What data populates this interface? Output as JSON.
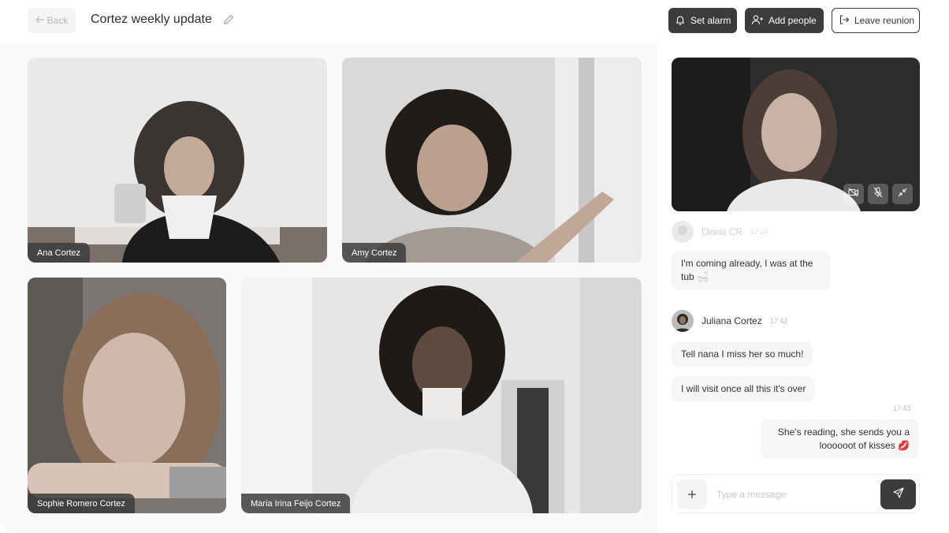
{
  "header": {
    "back_label": "Back",
    "title": "Cortez weekly update",
    "set_alarm_label": "Set alarm",
    "add_people_label": "Add people",
    "leave_label": "Leave reunion"
  },
  "participants": [
    {
      "name": "Ana Cortez"
    },
    {
      "name": "Amy Cortez"
    },
    {
      "name": "Sophie Romero Cortez"
    },
    {
      "name": "Maria Irina Feijo Cortez"
    }
  ],
  "chat": {
    "messages": [
      {
        "sender": "Diana CR",
        "time": "17:34",
        "bubbles": [
          "I'm coming already, I was at the tub 🛁"
        ]
      },
      {
        "sender": "Juliana Cortez",
        "time": "17:42",
        "bubbles": [
          "Tell nana I miss her so much!",
          "I will visit once all this it's over"
        ]
      },
      {
        "sender": "me",
        "time": "17:43",
        "bubbles": [
          "She's reading, she sends you a loooooot of kisses 💋"
        ]
      }
    ],
    "input_placeholder": "Type a message"
  },
  "icons": {
    "back": "arrow-left-icon",
    "edit": "pencil-icon",
    "alarm": "bell-icon",
    "add_people": "user-plus-icon",
    "leave": "logout-icon",
    "camera_off": "video-off-icon",
    "mic_off": "mic-off-icon",
    "minimize": "minimize-icon",
    "plus": "plus-icon",
    "send": "send-icon"
  },
  "colors": {
    "accent_dark": "#3c3c3c",
    "bubble_bg": "#f6f6f6",
    "muted_text": "#bdbdbd"
  }
}
